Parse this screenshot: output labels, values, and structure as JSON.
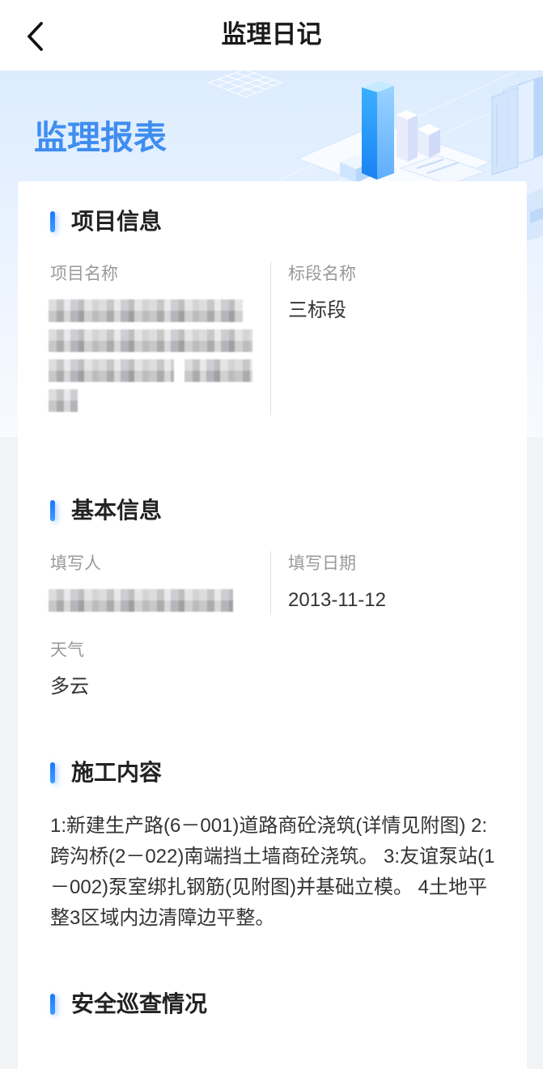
{
  "nav": {
    "title": "监理日记",
    "back_icon": "chevron-left-icon"
  },
  "banner": {
    "title": "监理报表"
  },
  "project_info": {
    "title": "项目信息",
    "project_name_label": "项目名称",
    "section_name_label": "标段名称",
    "section_name_value": "三标段"
  },
  "basic_info": {
    "title": "基本信息",
    "author_label": "填写人",
    "date_label": "填写日期",
    "date_value": "2013-11-12",
    "weather_label": "天气",
    "weather_value": "多云"
  },
  "construction": {
    "title": "施工内容",
    "content": "1:新建生产路(6－001)道路商砼浇筑(详情见附图) 2:跨沟桥(2－022)南端挡土墙商砼浇筑。 3:友谊泵站(1－002)泵室绑扎钢筋(见附图)并基础立模。 4土地平整3区域内边清障边平整。"
  },
  "safety": {
    "title": "安全巡查情况"
  },
  "colors": {
    "accent": "#2b80ff",
    "banner_title": "#3f8df0",
    "page_bg": "#f2f3f5",
    "label": "#9a9a9a",
    "value": "#333333"
  }
}
